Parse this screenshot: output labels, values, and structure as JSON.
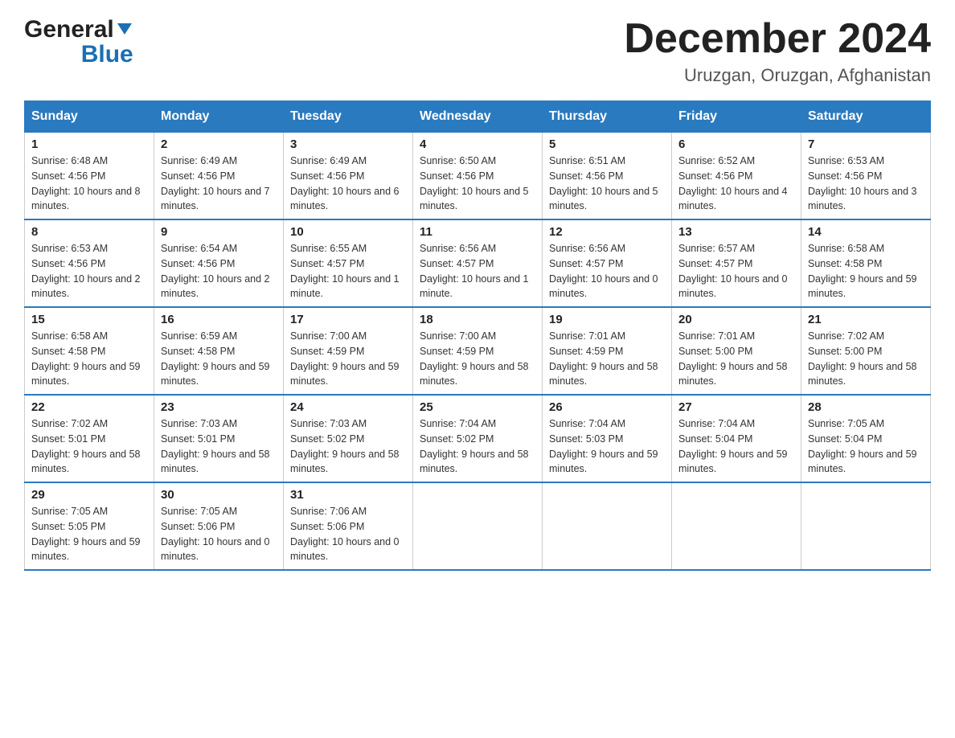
{
  "header": {
    "logo_general": "General",
    "logo_blue": "Blue",
    "title": "December 2024",
    "subtitle": "Uruzgan, Oruzgan, Afghanistan"
  },
  "days_of_week": [
    "Sunday",
    "Monday",
    "Tuesday",
    "Wednesday",
    "Thursday",
    "Friday",
    "Saturday"
  ],
  "weeks": [
    [
      {
        "day": "1",
        "sunrise": "6:48 AM",
        "sunset": "4:56 PM",
        "daylight": "10 hours and 8 minutes."
      },
      {
        "day": "2",
        "sunrise": "6:49 AM",
        "sunset": "4:56 PM",
        "daylight": "10 hours and 7 minutes."
      },
      {
        "day": "3",
        "sunrise": "6:49 AM",
        "sunset": "4:56 PM",
        "daylight": "10 hours and 6 minutes."
      },
      {
        "day": "4",
        "sunrise": "6:50 AM",
        "sunset": "4:56 PM",
        "daylight": "10 hours and 5 minutes."
      },
      {
        "day": "5",
        "sunrise": "6:51 AM",
        "sunset": "4:56 PM",
        "daylight": "10 hours and 5 minutes."
      },
      {
        "day": "6",
        "sunrise": "6:52 AM",
        "sunset": "4:56 PM",
        "daylight": "10 hours and 4 minutes."
      },
      {
        "day": "7",
        "sunrise": "6:53 AM",
        "sunset": "4:56 PM",
        "daylight": "10 hours and 3 minutes."
      }
    ],
    [
      {
        "day": "8",
        "sunrise": "6:53 AM",
        "sunset": "4:56 PM",
        "daylight": "10 hours and 2 minutes."
      },
      {
        "day": "9",
        "sunrise": "6:54 AM",
        "sunset": "4:56 PM",
        "daylight": "10 hours and 2 minutes."
      },
      {
        "day": "10",
        "sunrise": "6:55 AM",
        "sunset": "4:57 PM",
        "daylight": "10 hours and 1 minute."
      },
      {
        "day": "11",
        "sunrise": "6:56 AM",
        "sunset": "4:57 PM",
        "daylight": "10 hours and 1 minute."
      },
      {
        "day": "12",
        "sunrise": "6:56 AM",
        "sunset": "4:57 PM",
        "daylight": "10 hours and 0 minutes."
      },
      {
        "day": "13",
        "sunrise": "6:57 AM",
        "sunset": "4:57 PM",
        "daylight": "10 hours and 0 minutes."
      },
      {
        "day": "14",
        "sunrise": "6:58 AM",
        "sunset": "4:58 PM",
        "daylight": "9 hours and 59 minutes."
      }
    ],
    [
      {
        "day": "15",
        "sunrise": "6:58 AM",
        "sunset": "4:58 PM",
        "daylight": "9 hours and 59 minutes."
      },
      {
        "day": "16",
        "sunrise": "6:59 AM",
        "sunset": "4:58 PM",
        "daylight": "9 hours and 59 minutes."
      },
      {
        "day": "17",
        "sunrise": "7:00 AM",
        "sunset": "4:59 PM",
        "daylight": "9 hours and 59 minutes."
      },
      {
        "day": "18",
        "sunrise": "7:00 AM",
        "sunset": "4:59 PM",
        "daylight": "9 hours and 58 minutes."
      },
      {
        "day": "19",
        "sunrise": "7:01 AM",
        "sunset": "4:59 PM",
        "daylight": "9 hours and 58 minutes."
      },
      {
        "day": "20",
        "sunrise": "7:01 AM",
        "sunset": "5:00 PM",
        "daylight": "9 hours and 58 minutes."
      },
      {
        "day": "21",
        "sunrise": "7:02 AM",
        "sunset": "5:00 PM",
        "daylight": "9 hours and 58 minutes."
      }
    ],
    [
      {
        "day": "22",
        "sunrise": "7:02 AM",
        "sunset": "5:01 PM",
        "daylight": "9 hours and 58 minutes."
      },
      {
        "day": "23",
        "sunrise": "7:03 AM",
        "sunset": "5:01 PM",
        "daylight": "9 hours and 58 minutes."
      },
      {
        "day": "24",
        "sunrise": "7:03 AM",
        "sunset": "5:02 PM",
        "daylight": "9 hours and 58 minutes."
      },
      {
        "day": "25",
        "sunrise": "7:04 AM",
        "sunset": "5:02 PM",
        "daylight": "9 hours and 58 minutes."
      },
      {
        "day": "26",
        "sunrise": "7:04 AM",
        "sunset": "5:03 PM",
        "daylight": "9 hours and 59 minutes."
      },
      {
        "day": "27",
        "sunrise": "7:04 AM",
        "sunset": "5:04 PM",
        "daylight": "9 hours and 59 minutes."
      },
      {
        "day": "28",
        "sunrise": "7:05 AM",
        "sunset": "5:04 PM",
        "daylight": "9 hours and 59 minutes."
      }
    ],
    [
      {
        "day": "29",
        "sunrise": "7:05 AM",
        "sunset": "5:05 PM",
        "daylight": "9 hours and 59 minutes."
      },
      {
        "day": "30",
        "sunrise": "7:05 AM",
        "sunset": "5:06 PM",
        "daylight": "10 hours and 0 minutes."
      },
      {
        "day": "31",
        "sunrise": "7:06 AM",
        "sunset": "5:06 PM",
        "daylight": "10 hours and 0 minutes."
      },
      null,
      null,
      null,
      null
    ]
  ],
  "labels": {
    "sunrise": "Sunrise:",
    "sunset": "Sunset:",
    "daylight": "Daylight:"
  }
}
